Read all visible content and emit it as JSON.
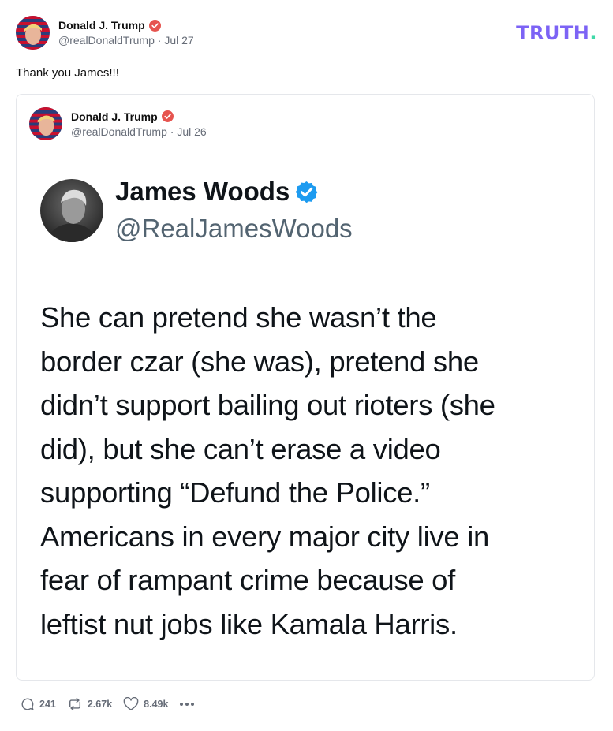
{
  "post": {
    "author_name": "Donald J. Trump",
    "author_handle": "@realDonaldTrump",
    "date_separator": "·",
    "date": "Jul 27",
    "text": "Thank you James!!!"
  },
  "brand": {
    "logo_text": "TRUTH",
    "logo_dot": ".",
    "logo_color": "#7c63f5",
    "dot_color": "#3fd9a8"
  },
  "quoted_post": {
    "author_name": "Donald J. Trump",
    "author_handle": "@realDonaldTrump",
    "date_separator": "·",
    "date": "Jul 26"
  },
  "embedded_tweet": {
    "name": "James Woods",
    "handle": "@RealJamesWoods",
    "body": "She can pretend she wasn’t the\nborder czar (she was), pretend she\ndidn’t support bailing out rioters (she\ndid), but she can’t erase a video\nsupporting “Defund the Police.”\nAmericans in every major city live in\nfear of rampant crime because of\nleftist nut jobs like Kamala Harris."
  },
  "actions": {
    "replies": "241",
    "retruths": "2.67k",
    "likes": "8.49k",
    "more_icon": "ellipsis-icon"
  },
  "colors": {
    "verified_badge": "#e6544f",
    "x_verified_badge": "#1d9bf0",
    "muted_text": "#676d78"
  }
}
